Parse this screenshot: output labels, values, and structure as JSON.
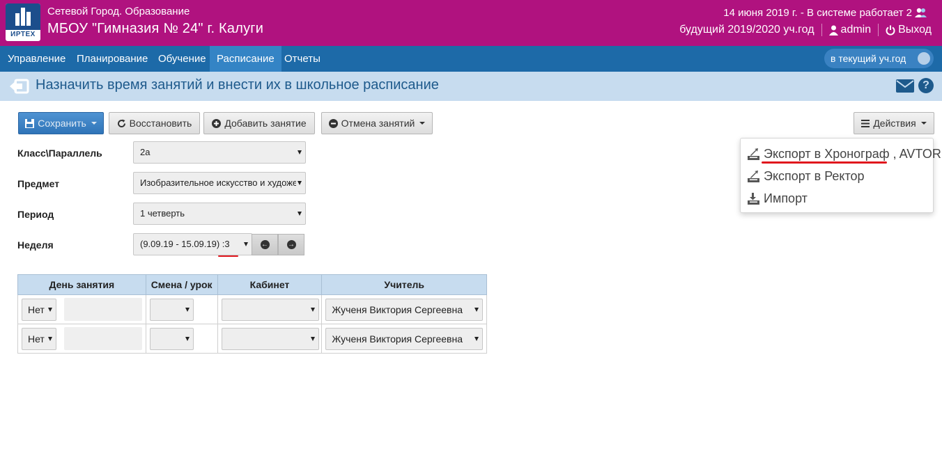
{
  "header": {
    "logo_text": "ИРТЕХ",
    "app_name": "Сетевой Город. Образование",
    "school_name": "МБОУ \"Гимназия № 24\" г. Калуги",
    "status": "14 июня 2019 г. - В системе работает 2",
    "year_label": "будущий 2019/2020 уч.год",
    "user": "admin",
    "logout": "Выход"
  },
  "nav": {
    "items": [
      "Управление",
      "Планирование",
      "Обучение",
      "Расписание",
      "Отчеты"
    ],
    "active": "Расписание",
    "year_toggle": "в текущий уч.год"
  },
  "page": {
    "title": "Назначить время занятий и внести их в школьное расписание"
  },
  "toolbar": {
    "save": "Сохранить",
    "restore": "Восстановить",
    "add_lesson": "Добавить занятие",
    "cancel_lessons": "Отмена занятий",
    "actions": "Действия"
  },
  "form": {
    "class_label": "Класс\\Параллель",
    "class_value": "2а",
    "subject_label": "Предмет",
    "subject_value": "Изобразительное искусство и художественный труд",
    "period_label": "Период",
    "period_value": "1 четверть",
    "week_label": "Неделя",
    "week_value": "(9.09.19 - 15.09.19) :3"
  },
  "table": {
    "headers": [
      "День занятия",
      "Смена / урок",
      "Кабинет",
      "Учитель"
    ],
    "rows": [
      {
        "day": "Нет",
        "teacher": "Жученя Виктория Сергеевна"
      },
      {
        "day": "Нет",
        "teacher": "Жученя Виктория Сергеевна"
      }
    ]
  },
  "actions_menu": {
    "export_chronograph": "Экспорт в Хронограф",
    "export_chronograph_suffix": "AVTOR",
    "export_rector": "Экспорт в Ректор",
    "import": "Импорт"
  },
  "colors": {
    "header_bg": "#b0127f",
    "nav_bg": "#1d6aa8",
    "nav_active": "#3484c5",
    "title_bar": "#c7dcef",
    "title_text": "#1e5a8c",
    "annotation_red": "#e0161d"
  }
}
